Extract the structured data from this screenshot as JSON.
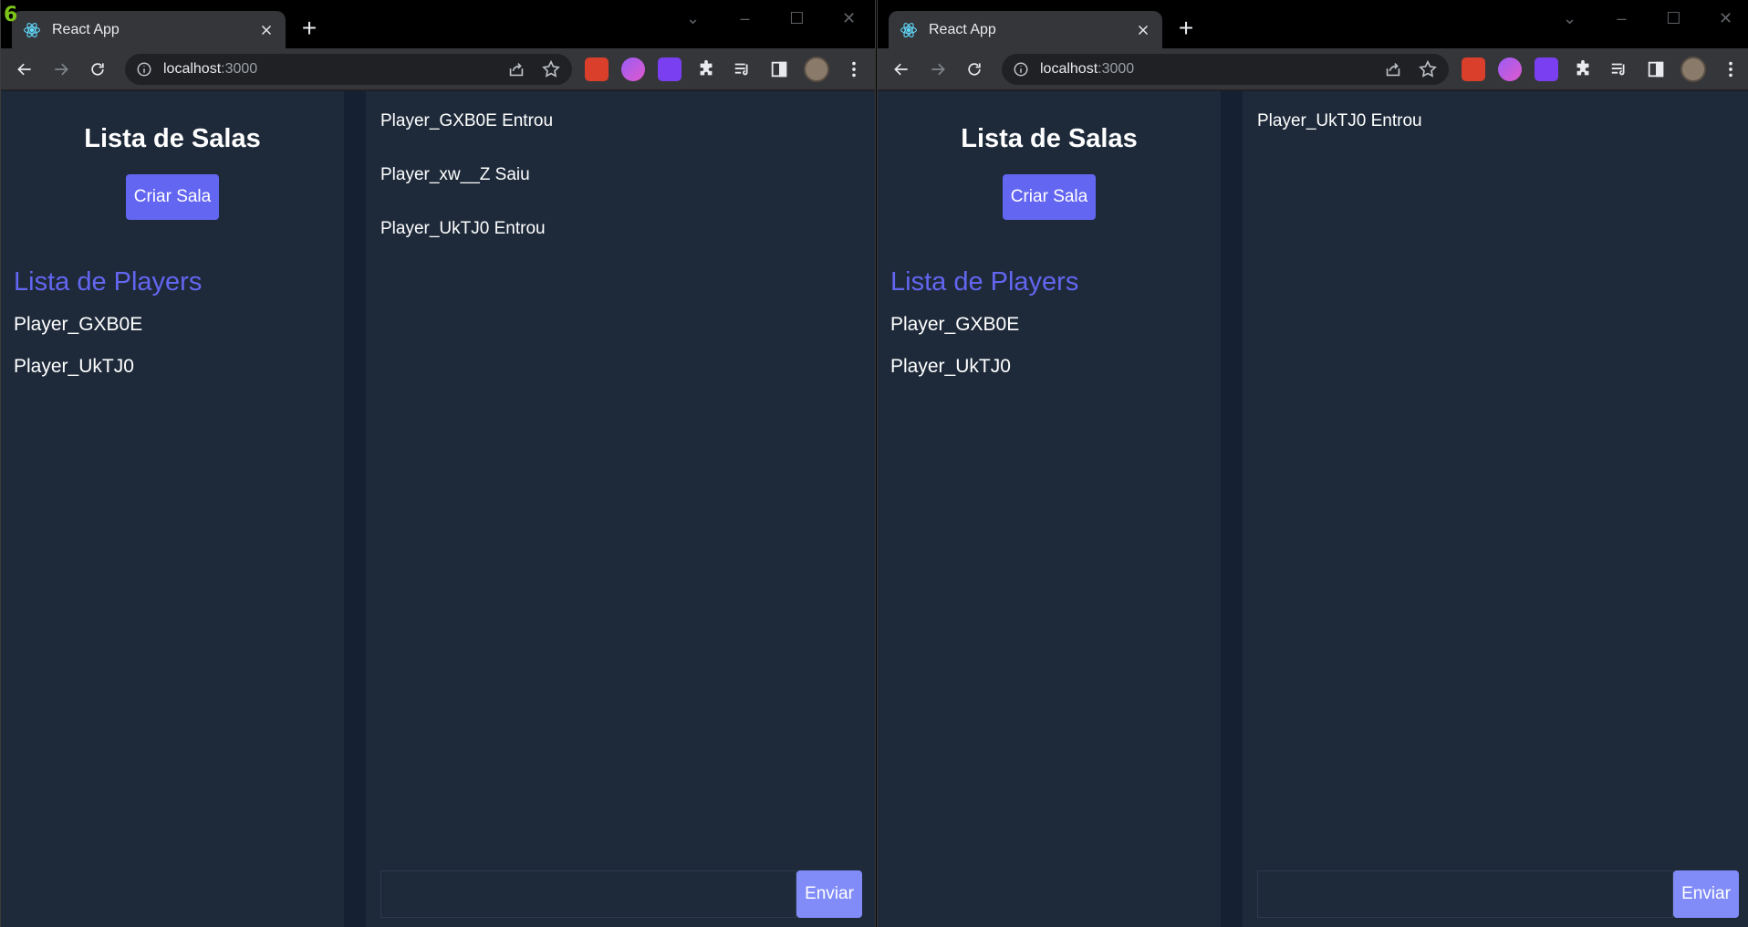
{
  "frame_label": "6",
  "windows": [
    {
      "tab_title": "React App",
      "url_host": "localhost",
      "url_port": ":3000",
      "rooms_title": "Lista de Salas",
      "create_room_label": "Criar Sala",
      "players_title": "Lista de Players",
      "players": [
        "Player_GXB0E",
        "Player_UkTJ0"
      ],
      "messages": [
        "Player_GXB0E Entrou",
        "Player_xw__Z Saiu",
        "Player_UkTJ0 Entrou"
      ],
      "message_input_value": "",
      "send_label": "Enviar"
    },
    {
      "tab_title": "React App",
      "url_host": "localhost",
      "url_port": ":3000",
      "rooms_title": "Lista de Salas",
      "create_room_label": "Criar Sala",
      "players_title": "Lista de Players",
      "players": [
        "Player_GXB0E",
        "Player_UkTJ0"
      ],
      "messages": [
        "Player_UkTJ0 Entrou"
      ],
      "message_input_value": "",
      "send_label": "Enviar"
    }
  ],
  "colors": {
    "accent": "#6366f1",
    "send_button": "#818cf8",
    "app_background": "#1e2a3a",
    "divider": "#152032"
  },
  "icons": [
    "react-favicon-icon",
    "close-icon",
    "plus-icon",
    "chevron-down-icon",
    "minimize-icon",
    "maximize-icon",
    "back-icon",
    "forward-icon",
    "reload-icon",
    "info-icon",
    "share-icon",
    "star-icon",
    "puzzle-icon",
    "media-icon",
    "sidepanel-icon",
    "kebab-menu-icon"
  ]
}
